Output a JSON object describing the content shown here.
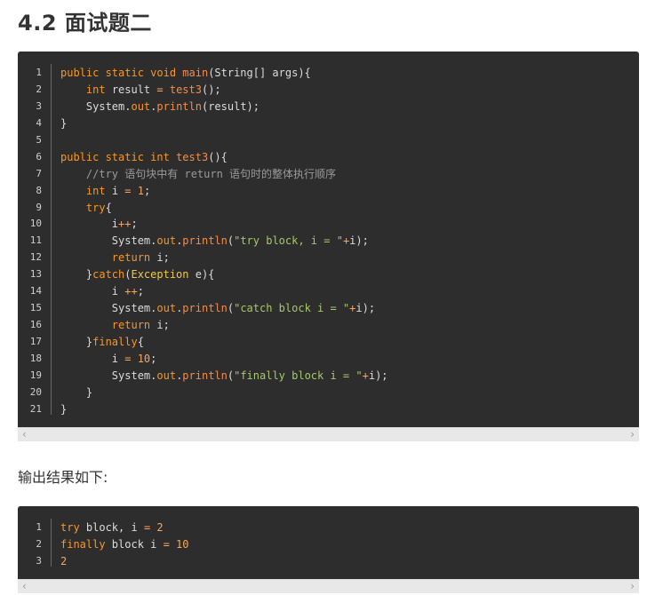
{
  "heading": "4.2 面试题二",
  "code_block_1": {
    "lines": [
      {
        "n": "1",
        "segs": [
          [
            "k",
            "public "
          ],
          [
            "k",
            "static "
          ],
          [
            "k",
            "void "
          ],
          [
            "f",
            "main"
          ],
          [
            "p",
            "(String[] args){"
          ]
        ]
      },
      {
        "n": "2",
        "segs": [
          [
            "p",
            "    "
          ],
          [
            "k",
            "int "
          ],
          [
            "p",
            "result "
          ],
          [
            "n",
            "= "
          ],
          [
            "f",
            "test3"
          ],
          [
            "p",
            "();"
          ]
        ]
      },
      {
        "n": "3",
        "segs": [
          [
            "p",
            "    System."
          ],
          [
            "k",
            "out"
          ],
          [
            "p",
            "."
          ],
          [
            "f",
            "println"
          ],
          [
            "p",
            "(result);"
          ]
        ]
      },
      {
        "n": "4",
        "segs": [
          [
            "p",
            "}"
          ]
        ]
      },
      {
        "n": "5",
        "segs": [
          [
            "p",
            ""
          ]
        ]
      },
      {
        "n": "6",
        "segs": [
          [
            "k",
            "public "
          ],
          [
            "k",
            "static "
          ],
          [
            "k",
            "int "
          ],
          [
            "f",
            "test3"
          ],
          [
            "p",
            "(){"
          ]
        ]
      },
      {
        "n": "7",
        "segs": [
          [
            "c",
            "    //try 语句块中有 return 语句时的整体执行顺序"
          ]
        ]
      },
      {
        "n": "8",
        "segs": [
          [
            "p",
            "    "
          ],
          [
            "k",
            "int "
          ],
          [
            "p",
            "i "
          ],
          [
            "n",
            "= 1"
          ],
          [
            "p",
            ";"
          ]
        ]
      },
      {
        "n": "9",
        "segs": [
          [
            "p",
            "    "
          ],
          [
            "k",
            "try"
          ],
          [
            "p",
            "{"
          ]
        ]
      },
      {
        "n": "10",
        "segs": [
          [
            "p",
            "        i"
          ],
          [
            "n",
            "++"
          ],
          [
            "p",
            ";"
          ]
        ]
      },
      {
        "n": "11",
        "segs": [
          [
            "p",
            "        System."
          ],
          [
            "k",
            "out"
          ],
          [
            "p",
            "."
          ],
          [
            "f",
            "println"
          ],
          [
            "p",
            "("
          ],
          [
            "s",
            "\"try block, i = \""
          ],
          [
            "n",
            "+"
          ],
          [
            "p",
            "i);"
          ]
        ]
      },
      {
        "n": "12",
        "segs": [
          [
            "p",
            "        "
          ],
          [
            "k",
            "return "
          ],
          [
            "p",
            "i;"
          ]
        ]
      },
      {
        "n": "13",
        "segs": [
          [
            "p",
            "    }"
          ],
          [
            "k",
            "catch"
          ],
          [
            "p",
            "("
          ],
          [
            "y",
            "Exception "
          ],
          [
            "p",
            "e){"
          ]
        ]
      },
      {
        "n": "14",
        "segs": [
          [
            "p",
            "        i "
          ],
          [
            "n",
            "++"
          ],
          [
            "p",
            ";"
          ]
        ]
      },
      {
        "n": "15",
        "segs": [
          [
            "p",
            "        System."
          ],
          [
            "k",
            "out"
          ],
          [
            "p",
            "."
          ],
          [
            "f",
            "println"
          ],
          [
            "p",
            "("
          ],
          [
            "s",
            "\"catch block i = \""
          ],
          [
            "n",
            "+"
          ],
          [
            "p",
            "i);"
          ]
        ]
      },
      {
        "n": "16",
        "segs": [
          [
            "p",
            "        "
          ],
          [
            "k",
            "return "
          ],
          [
            "p",
            "i;"
          ]
        ]
      },
      {
        "n": "17",
        "segs": [
          [
            "p",
            "    }"
          ],
          [
            "k",
            "finally"
          ],
          [
            "p",
            "{"
          ]
        ]
      },
      {
        "n": "18",
        "segs": [
          [
            "p",
            "        i "
          ],
          [
            "n",
            "= 10"
          ],
          [
            "p",
            ";"
          ]
        ]
      },
      {
        "n": "19",
        "segs": [
          [
            "p",
            "        System."
          ],
          [
            "k",
            "out"
          ],
          [
            "p",
            "."
          ],
          [
            "f",
            "println"
          ],
          [
            "p",
            "("
          ],
          [
            "s",
            "\"finally block i = \""
          ],
          [
            "n",
            "+"
          ],
          [
            "p",
            "i);"
          ]
        ]
      },
      {
        "n": "20",
        "segs": [
          [
            "p",
            "    }"
          ]
        ]
      },
      {
        "n": "21",
        "segs": [
          [
            "p",
            "}"
          ]
        ]
      }
    ]
  },
  "paragraph": "输出结果如下:",
  "code_block_2": {
    "lines": [
      {
        "n": "1",
        "segs": [
          [
            "k",
            "try "
          ],
          [
            "p",
            "block, i "
          ],
          [
            "n",
            "= 2"
          ]
        ]
      },
      {
        "n": "2",
        "segs": [
          [
            "k",
            "finally "
          ],
          [
            "p",
            "block i "
          ],
          [
            "n",
            "= 10"
          ]
        ]
      },
      {
        "n": "3",
        "segs": [
          [
            "n",
            "2"
          ]
        ]
      }
    ]
  },
  "scrollbar": {
    "left_arrow": "‹",
    "right_arrow": "›"
  },
  "colors": {
    "code_bg": "#2d2d2d",
    "keyword": "#fd971f",
    "function": "#f58c4b",
    "string": "#a6c86a",
    "number": "#f8a65b",
    "comment": "#9a9a9a",
    "type": "#f1c84b"
  }
}
